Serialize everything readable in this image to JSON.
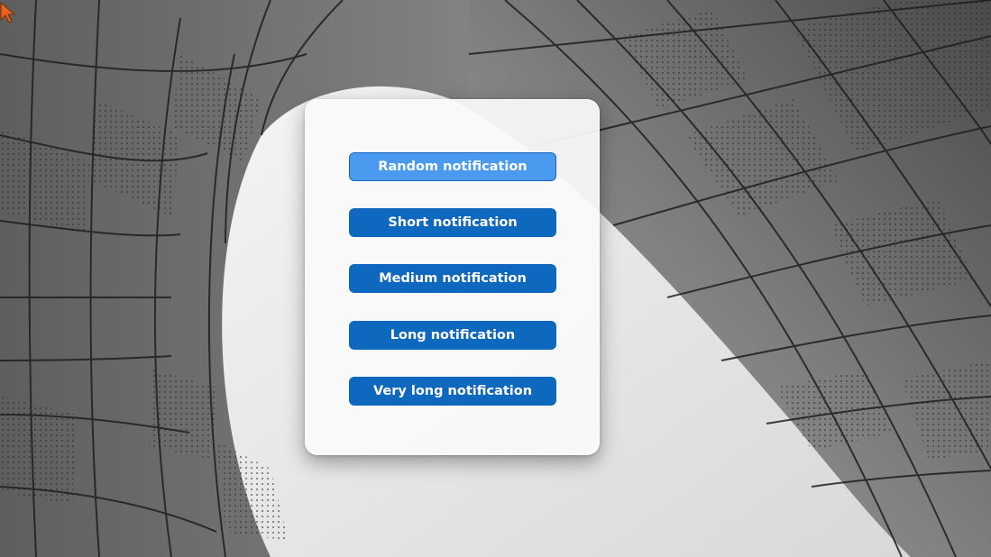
{
  "dialog": {
    "buttons": [
      {
        "label": "Random notification",
        "state": "focused"
      },
      {
        "label": "Short notification",
        "state": "normal"
      },
      {
        "label": "Medium notification",
        "state": "normal"
      },
      {
        "label": "Long notification",
        "state": "normal"
      },
      {
        "label": "Very long notification",
        "state": "normal"
      }
    ]
  },
  "colors": {
    "button_bg": "#0e68bd",
    "button_focused_bg": "#4a9bf0",
    "button_text": "#ffffff",
    "dialog_bg": "#fafafa",
    "cursor": "#e8641e"
  },
  "icons": {
    "cursor": "mouse-pointer-icon"
  }
}
